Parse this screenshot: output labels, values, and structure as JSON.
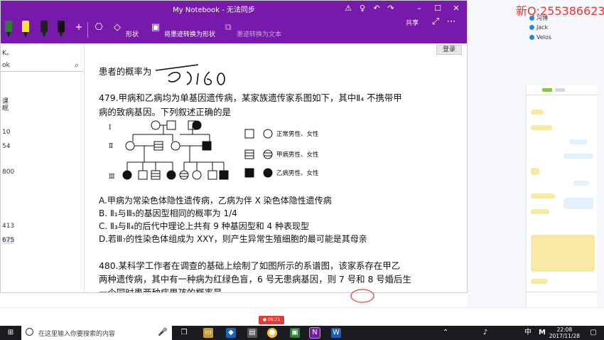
{
  "window": {
    "title": "My Notebook - 无法同步"
  },
  "ribbon": {
    "shapes_label": "形状",
    "ink_to_shape_label": "将墨迹转换为形状",
    "ink_to_text_label": "墨迹转换为文本",
    "share_label": "共享"
  },
  "leftpane": {
    "item1": "K。",
    "search_value": "ok",
    "item2": "课",
    "item3": "眠",
    "n1": "10",
    "n2": "54",
    "n3": "800",
    "n4": "413",
    "n5": "675"
  },
  "page": {
    "login_label": "登录",
    "q478_line": "患者的概率为",
    "q478_answer": "5/160",
    "q479_line1": "479.甲病和乙病均为单基因遗传病，某家族遗传家系图如下，其中Ⅱ₄ 不携带甲",
    "q479_line2": "病的致病基因。下列叙述正确的是",
    "legend_normal": "正常男性、女性",
    "legend_a": "甲病男性、女性",
    "legend_b": "乙病男性、女性",
    "gen1": "Ⅰ",
    "gen2": "Ⅱ",
    "gen3": "Ⅲ",
    "optA": "A.甲病为常染色体隐性遗传病，乙病为伴 X 染色体隐性遗传病",
    "optB": "B. Ⅱ₁与Ⅲ₅的基因型相同的概率为 1/4",
    "optC": "C. Ⅱ₃与Ⅱ₄的后代中理论上共有 9 种基因型和 4 种表现型",
    "optD": "D.若Ⅲ₇的性染色体组成为 XXY，则产生异常生殖细胞的最可能是其母亲",
    "q480_line1": "480.某科学工作者在调查的基础上绘制了如图所示的系谱图，该家系存在甲乙",
    "q480_line2": "两种遗传病，其中有一种病为红绿色盲，6 号无患病基因，则 7 号和 8 号婚后生",
    "q480_line3": "一个同时患两种病男孩的概率是"
  },
  "users": [
    "冯博",
    "Jack",
    "Velos"
  ],
  "watermark": "新Q:255386623",
  "taskbar": {
    "search_placeholder": "在这里输入你要搜索的内容",
    "time": "22:08",
    "date": "2017/11/28",
    "ime": "中"
  }
}
